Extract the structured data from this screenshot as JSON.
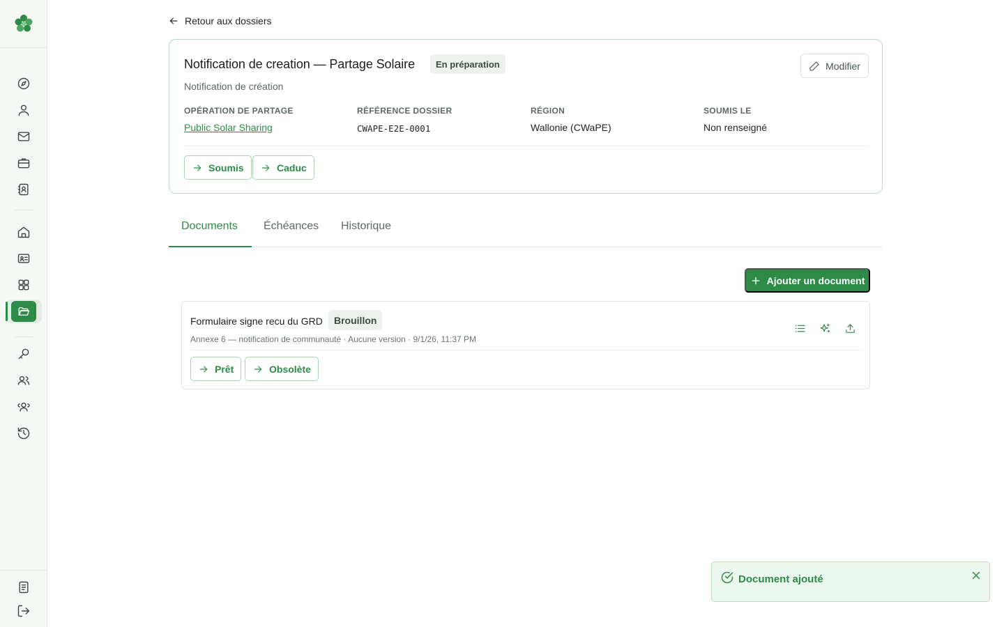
{
  "nav": {
    "back_label": "Retour aux dossiers"
  },
  "dossier": {
    "title": "Notification de creation — Partage Solaire",
    "status": "En préparation",
    "subtitle": "Notification de création",
    "edit_label": "Modifier",
    "fields": [
      {
        "label": "OPÉRATION DE PARTAGE",
        "value": "Public Solar Sharing"
      },
      {
        "label": "RÉFÉRENCE DOSSIER",
        "value": "CWAPE-E2E-0001"
      },
      {
        "label": "RÉGION",
        "value": "Wallonie (CWaPE)"
      },
      {
        "label": "SOUMIS LE",
        "value": "Non renseigné"
      }
    ],
    "transitions": [
      "Soumis",
      "Caduc"
    ]
  },
  "tabs": [
    {
      "label": "Documents",
      "active": true
    },
    {
      "label": "Échéances",
      "active": false
    },
    {
      "label": "Historique",
      "active": false
    }
  ],
  "documents": {
    "add_label": "Ajouter un document",
    "items": [
      {
        "title": "Formulaire signe recu du GRD",
        "status": "Brouillon",
        "meta": "Annexe 6 — notification de communauté · Aucune version · 9/1/26, 11:37 PM",
        "transitions": [
          "Prêt",
          "Obsolète"
        ]
      }
    ]
  },
  "toast": {
    "message": "Document ajouté"
  },
  "sidebar": {
    "icons": [
      "compass-icon",
      "user-icon",
      "mail-icon",
      "briefcase-icon",
      "contact-book-icon",
      "home-icon",
      "id-card-icon",
      "grid-icon",
      "folder-open-icon",
      "key-icon",
      "users-icon",
      "users-group-icon",
      "history-icon",
      "document-icon",
      "logout-icon"
    ]
  },
  "colors": {
    "accent": "#2e8b47",
    "accent_light": "#ecf7ef",
    "border_accent": "#b9dcc2"
  }
}
